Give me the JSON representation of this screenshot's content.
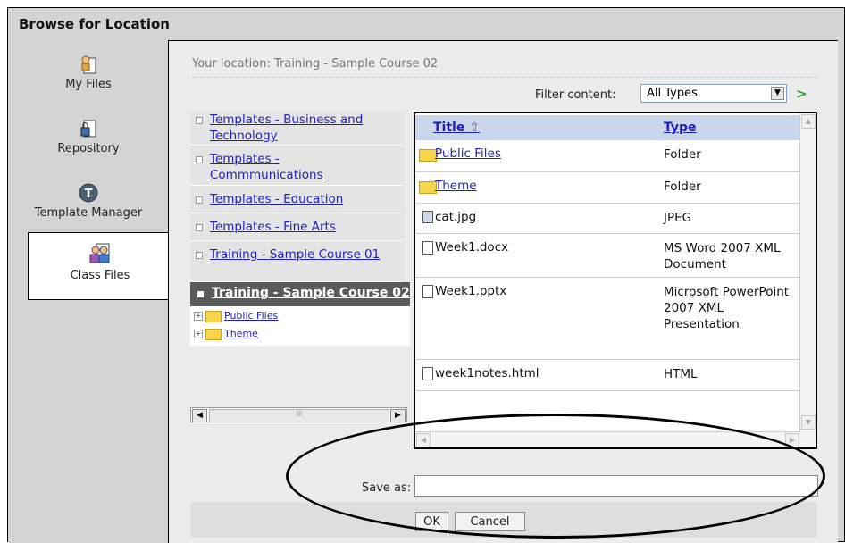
{
  "window": {
    "title": "Browse for Location"
  },
  "nav": {
    "items": [
      {
        "label": "My Files",
        "icon": "my-files-icon"
      },
      {
        "label": "Repository",
        "icon": "repository-icon"
      },
      {
        "label": "Template Manager",
        "icon": "template-manager-icon"
      },
      {
        "label": "Class Files",
        "icon": "class-files-icon",
        "selected": true
      }
    ]
  },
  "location": {
    "text": "Your location: Training - Sample Course 02"
  },
  "filter": {
    "label": "Filter content:",
    "value": "All Types"
  },
  "tree": {
    "items": [
      {
        "label": "Templates - Business and Technology"
      },
      {
        "label": "Templates - Commmunications"
      },
      {
        "label": "Templates - Education"
      },
      {
        "label": "Templates - Fine Arts"
      },
      {
        "label": "Training - Sample Course 01"
      }
    ],
    "selected": {
      "label": "Training - Sample Course 02"
    },
    "children": [
      {
        "label": "Public Files"
      },
      {
        "label": "Theme"
      }
    ],
    "hscroll_thumb": "III"
  },
  "table": {
    "columns": {
      "title": "Title",
      "sort_indicator": "⇧",
      "type": "Type"
    },
    "rows": [
      {
        "name": "Public Files",
        "type": "Folder"
      },
      {
        "name": "Theme",
        "type": "Folder"
      },
      {
        "name": "cat.jpg",
        "type": "JPEG"
      },
      {
        "name": "Week1.docx",
        "type": "MS Word 2007 XML Document"
      },
      {
        "name": "Week1.pptx",
        "type": "Microsoft PowerPoint 2007 XML Presentation"
      },
      {
        "name": "week1notes.html",
        "type": "HTML"
      }
    ]
  },
  "save": {
    "label": "Save as:",
    "value": ""
  },
  "buttons": {
    "ok": "OK",
    "cancel": "Cancel"
  }
}
